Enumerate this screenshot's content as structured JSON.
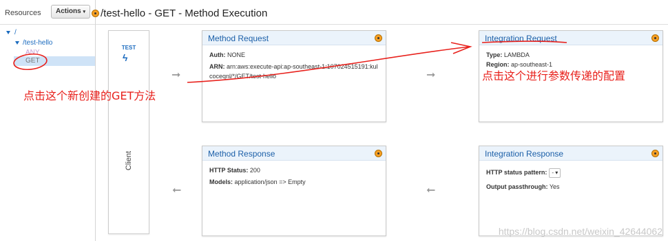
{
  "sidebar": {
    "title": "Resources",
    "actions_label": "Actions",
    "tree": {
      "root": "/",
      "resource": "/test-hello",
      "methods": [
        "ANY",
        "GET"
      ]
    }
  },
  "header": {
    "title": "/test-hello - GET - Method Execution"
  },
  "client": {
    "test_label": "TEST",
    "bolt": "ϟ",
    "label": "Client"
  },
  "method_request": {
    "title": "Method Request",
    "auth_label": "Auth:",
    "auth_value": "NONE",
    "arn_label": "ARN:",
    "arn_value": "arn:aws:execute-api:ap-southeast-1:107024515191:kulcoceqnl/*/GET/test-hello"
  },
  "integration_request": {
    "title": "Integration Request",
    "type_label": "Type:",
    "type_value": "LAMBDA",
    "region_label": "Region:",
    "region_value": "ap-southeast-1"
  },
  "method_response": {
    "title": "Method Response",
    "status_label": "HTTP Status:",
    "status_value": "200",
    "models_label": "Models:",
    "models_value": "application/json => Empty"
  },
  "integration_response": {
    "title": "Integration Response",
    "pattern_label": "HTTP status pattern:",
    "pattern_value": "-",
    "passthrough_label": "Output passthrough:",
    "passthrough_value": "Yes"
  },
  "annotations": {
    "left": "点击这个新创建的GET方法",
    "right": "点击这个进行参数传递的配置"
  },
  "watermark": "https://blog.csdn.net/weixin_42644062",
  "colors": {
    "accent": "#1b6bbf",
    "annotation": "#e8201b",
    "indicator": "#f7a024"
  }
}
